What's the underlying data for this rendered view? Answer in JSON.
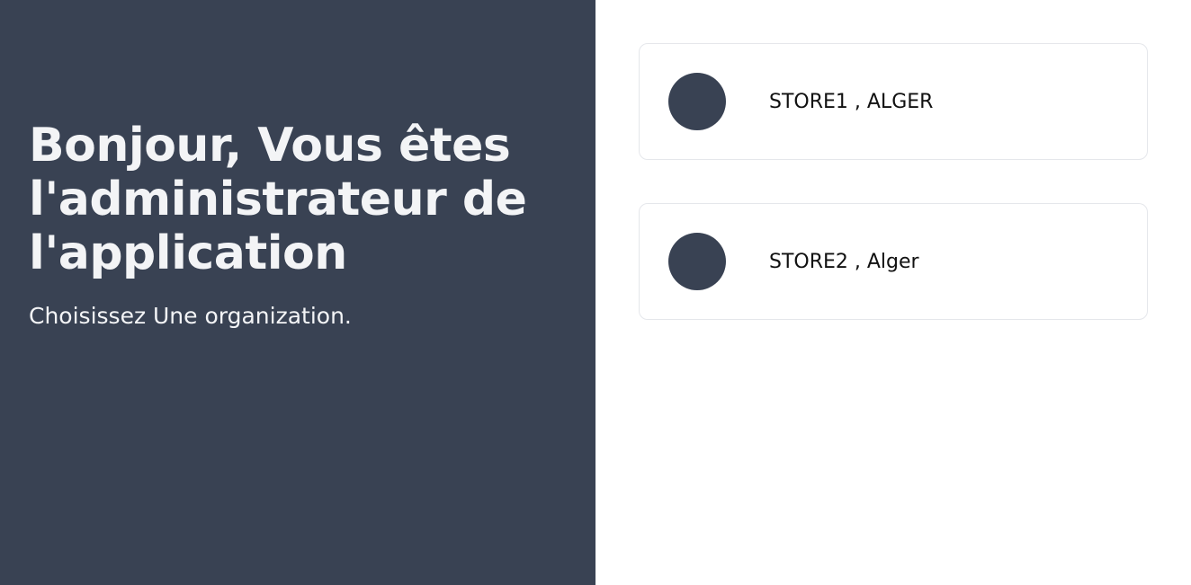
{
  "welcome": {
    "headline": "Bonjour, Vous êtes l'administrateur de l'application",
    "subtitle": "Choisissez Une organization."
  },
  "organizations": [
    {
      "label": "STORE1 , ALGER"
    },
    {
      "label": "STORE2 , Alger"
    }
  ],
  "colors": {
    "panel_background": "#394253",
    "panel_text": "#f3f4f6",
    "avatar": "#394253",
    "card_border": "#e5e7eb"
  }
}
